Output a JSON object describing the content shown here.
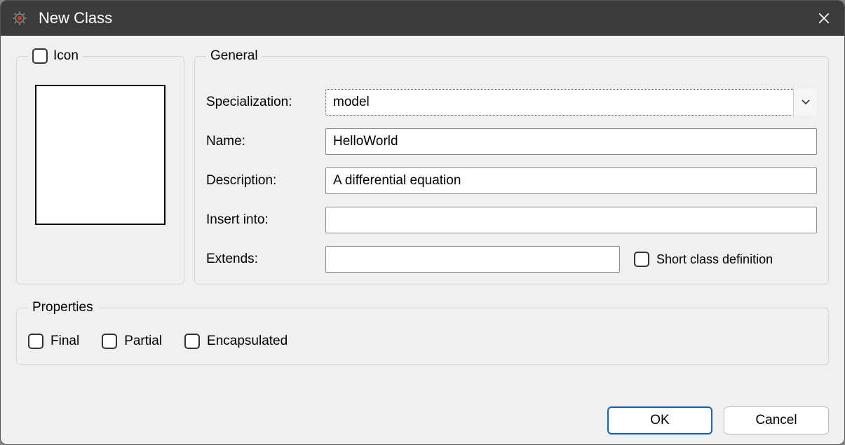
{
  "window": {
    "title": "New Class"
  },
  "icon_group": {
    "legend": "Icon",
    "checked": false
  },
  "general": {
    "legend": "General",
    "specialization": {
      "label": "Specialization:",
      "value": "model"
    },
    "name": {
      "label": "Name:",
      "value": "HelloWorld"
    },
    "description": {
      "label": "Description:",
      "value": "A differential equation"
    },
    "insert_into": {
      "label": "Insert into:",
      "value": ""
    },
    "extends": {
      "label": "Extends:",
      "value": ""
    },
    "short_class_def": {
      "label": "Short class definition",
      "checked": false
    }
  },
  "properties": {
    "legend": "Properties",
    "final": {
      "label": "Final",
      "checked": false
    },
    "partial": {
      "label": "Partial",
      "checked": false
    },
    "encapsulated": {
      "label": "Encapsulated",
      "checked": false
    }
  },
  "buttons": {
    "ok": "OK",
    "cancel": "Cancel"
  }
}
